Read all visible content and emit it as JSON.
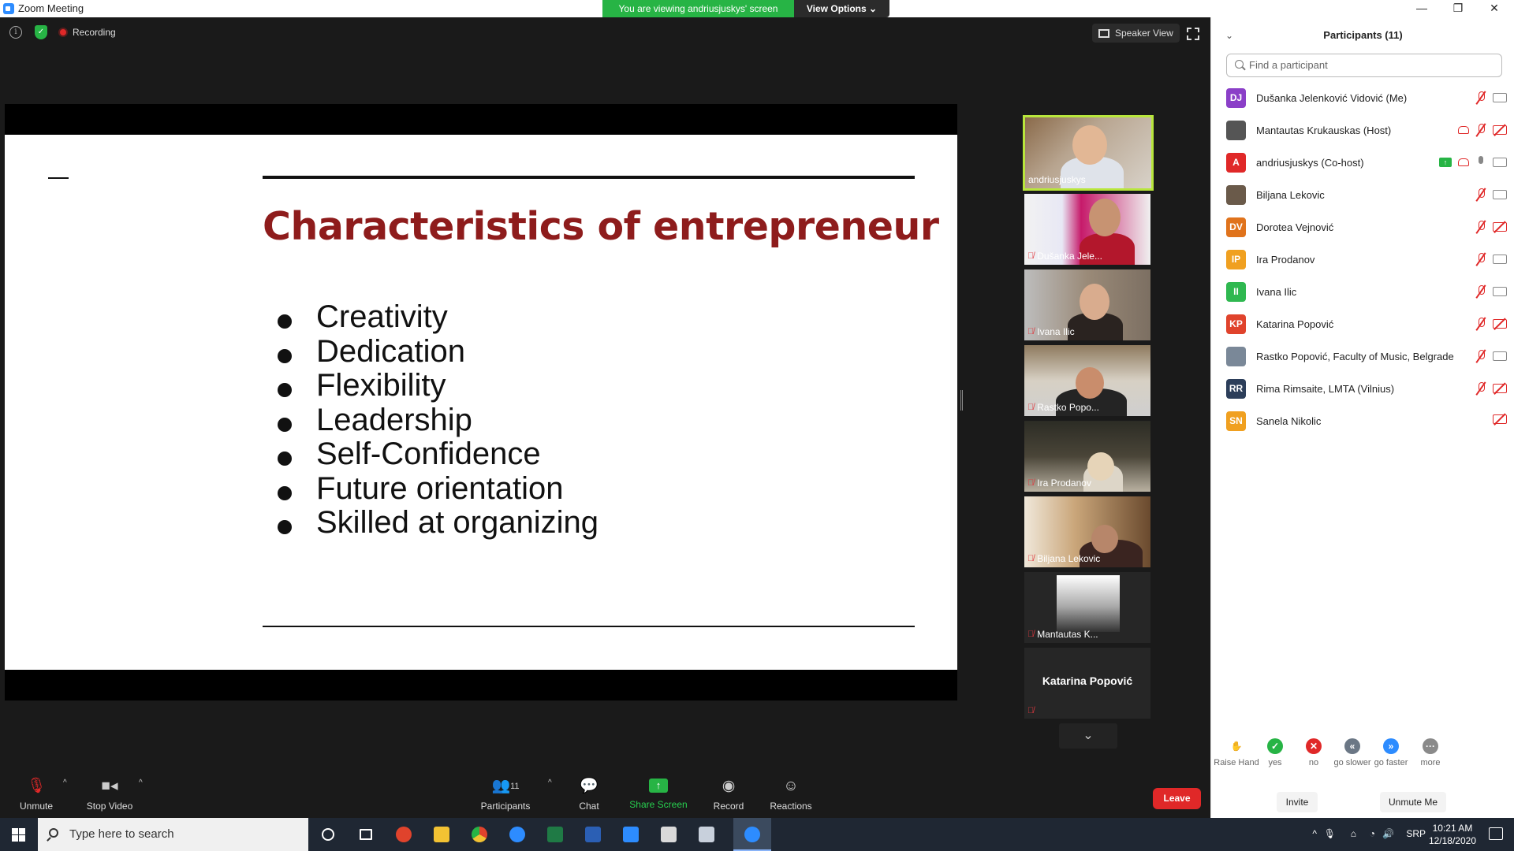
{
  "window": {
    "title": "Zoom Meeting",
    "viewing_banner": "You are viewing andriusjuskys' screen",
    "view_options": "View Options",
    "controls": [
      "—",
      "❐",
      "✕"
    ]
  },
  "meeting": {
    "recording_label": "Recording",
    "speaker_view_label": "Speaker View"
  },
  "slide": {
    "title": "Characteristics of entrepreneur",
    "bullets": [
      "Creativity",
      "Dedication",
      "Flexibility",
      "Leadership",
      "Self-Confidence",
      "Future orientation",
      "Skilled at organizing"
    ]
  },
  "thumbnails": [
    {
      "name": "andriusjuskys",
      "muted": false,
      "active_speaker": true
    },
    {
      "name": "Dušanka Jele...",
      "muted": true
    },
    {
      "name": "Ivana Ilic",
      "muted": true
    },
    {
      "name": "Rastko Popo...",
      "muted": true
    },
    {
      "name": "Ira Prodanov",
      "muted": true
    },
    {
      "name": "Biljana Lekovic",
      "muted": true
    },
    {
      "name": "Mantautas K...",
      "muted": true
    },
    {
      "name": "Katarina Popović",
      "muted": true
    }
  ],
  "toolbar": {
    "unmute": "Unmute",
    "stop_video": "Stop Video",
    "participants": "Participants",
    "participants_count": "11",
    "chat": "Chat",
    "share_screen": "Share Screen",
    "record": "Record",
    "reactions": "Reactions",
    "leave": "Leave"
  },
  "panel": {
    "title": "Participants (11)",
    "search_placeholder": "Find a participant",
    "participants": [
      {
        "initials": "DJ",
        "name": "Dušanka Jelenković Vidović (Me)",
        "color": "#8b3fc8",
        "mic": "off",
        "cam": "on"
      },
      {
        "initials": "",
        "name": "Mantautas Krukauskas (Host)",
        "color": "#555555",
        "mic": "off",
        "cam": "off",
        "recording": true
      },
      {
        "initials": "A",
        "name": "andriusjuskys (Co-host)",
        "color": "#e02828",
        "mic": "on",
        "cam": "on",
        "recording": true,
        "sharing": true
      },
      {
        "initials": "",
        "name": "Biljana Lekovic",
        "color": "#6a5a4a",
        "mic": "off",
        "cam": "on"
      },
      {
        "initials": "DV",
        "name": "Dorotea Vejnović",
        "color": "#e0731c",
        "mic": "off",
        "cam": "off"
      },
      {
        "initials": "IP",
        "name": "Ira Prodanov",
        "color": "#f0a020",
        "mic": "off",
        "cam": "on"
      },
      {
        "initials": "II",
        "name": "Ivana Ilic",
        "color": "#2fb850",
        "mic": "off",
        "cam": "on"
      },
      {
        "initials": "KP",
        "name": "Katarina Popović",
        "color": "#e0432c",
        "mic": "off",
        "cam": "off"
      },
      {
        "initials": "",
        "name": "Rastko Popović, Faculty of Music, Belgrade",
        "color": "#7a8898",
        "mic": "off",
        "cam": "on"
      },
      {
        "initials": "RR",
        "name": "Rima Rimsaite, LMTA (Vilnius)",
        "color": "#2c3e5a",
        "mic": "off",
        "cam": "off"
      },
      {
        "initials": "SN",
        "name": "Sanela Nikolic",
        "color": "#f0a020",
        "mic": "none",
        "cam": "off"
      }
    ],
    "reactions": [
      {
        "label": "Raise Hand",
        "glyph": "✋",
        "color": "#ffffff",
        "fg": "#2d8cff"
      },
      {
        "label": "yes",
        "glyph": "✓",
        "color": "#27b445",
        "fg": "#ffffff"
      },
      {
        "label": "no",
        "glyph": "✕",
        "color": "#e02828",
        "fg": "#ffffff"
      },
      {
        "label": "go slower",
        "glyph": "«",
        "color": "#6b7785",
        "fg": "#ffffff"
      },
      {
        "label": "go faster",
        "glyph": "»",
        "color": "#2d8cff",
        "fg": "#ffffff"
      },
      {
        "label": "more",
        "glyph": "···",
        "color": "#8a8a8a",
        "fg": "#ffffff"
      }
    ],
    "invite": "Invite",
    "unmute_me": "Unmute Me"
  },
  "taskbar": {
    "search_placeholder": "Type here to search",
    "language": "SRP",
    "time": "10:21 AM",
    "date": "12/18/2020"
  }
}
